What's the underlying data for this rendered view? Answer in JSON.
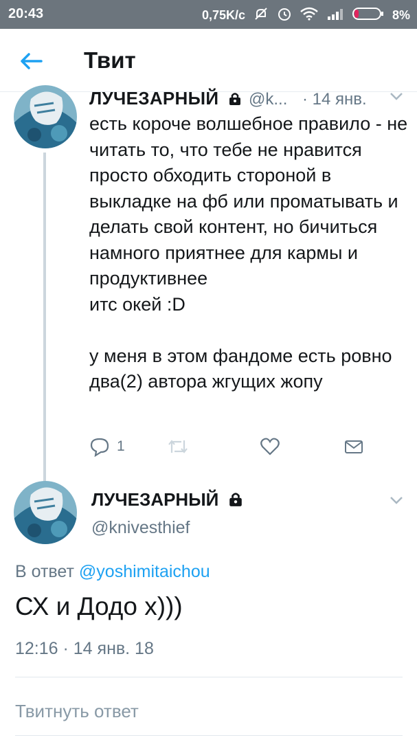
{
  "status_bar": {
    "time": "20:43",
    "network_speed": "0,75K/c",
    "battery": "8%"
  },
  "app_bar": {
    "title": "Твит",
    "back_icon": "arrow-left-icon"
  },
  "colors": {
    "accent": "#1da1f2",
    "secondary_text": "#657786",
    "status_bar": "#6c757d",
    "thread_line": "#ccd6dd",
    "battery_low": "#e0245e"
  },
  "parent_tweet": {
    "author_name": "ЛУЧЕЗАРНЫЙ",
    "handle": "@k...",
    "date": "· 14 янв.",
    "paragraphs": [
      "есть короче волшебное правило - не читать то, что тебе не нравится просто обходить стороной в выкладке на фб или проматывать и делать свой контент, но бичиться намного приятнее для кармы и продуктивнее\nитс окей :D",
      "у меня в этом фандоме есть ровно два(2) автора жгущих жопу"
    ],
    "reply_count": "1"
  },
  "main_tweet": {
    "author_name": "ЛУЧЕЗАРНЫЙ",
    "handle": "@knivesthief",
    "reply_prefix": "В ответ",
    "reply_mention": "@yoshimitaichou",
    "text": "СХ и Додо х)))",
    "timestamp": "12:16 · 14 янв. 18"
  },
  "reply_input": {
    "placeholder": "Твитнуть ответ"
  }
}
